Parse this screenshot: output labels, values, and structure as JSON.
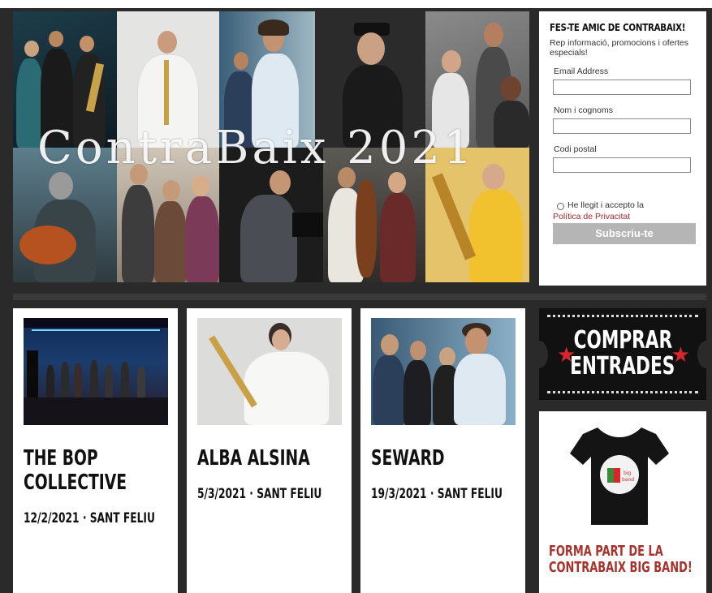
{
  "hero": {
    "title": "ContraBaix 2021"
  },
  "newsletter": {
    "title": "FES-TE AMIC DE CONTRABAIX!",
    "subtitle": "Rep informació, promocions i ofertes especials!",
    "email_label": "Email Address",
    "name_label": "Nom i cognoms",
    "postal_label": "Codi postal",
    "email_value": "",
    "name_value": "",
    "postal_value": "",
    "accept_text": "He llegit i accepto la",
    "privacy_link": "Política de Privacitat",
    "subscribe_label": "Subscriu-te"
  },
  "concerts": [
    {
      "name_line1": "THE BOP",
      "name_line2": "COLLECTIVE",
      "date": "12/2/2021 · SANT FELIU"
    },
    {
      "name_line1": "ALBA ALSINA",
      "name_line2": "",
      "date": "5/3/2021 · SANT FELIU"
    },
    {
      "name_line1": "SEWARD",
      "name_line2": "",
      "date": "19/3/2021 · SANT FELIU"
    }
  ],
  "tickets": {
    "line1": "COMPRAR",
    "line2": "ENTRADES",
    "star_icon": "star-icon"
  },
  "promo": {
    "line1": "FORMA PART DE LA",
    "line2": "CONTRABAIX BIG BAND!",
    "shirt_icon": "tshirt-icon"
  },
  "colors": {
    "background": "#2a2a2a",
    "accent_red": "#d9262c",
    "promo_red": "#a8322b",
    "button_grey": "#b5b5b5"
  }
}
